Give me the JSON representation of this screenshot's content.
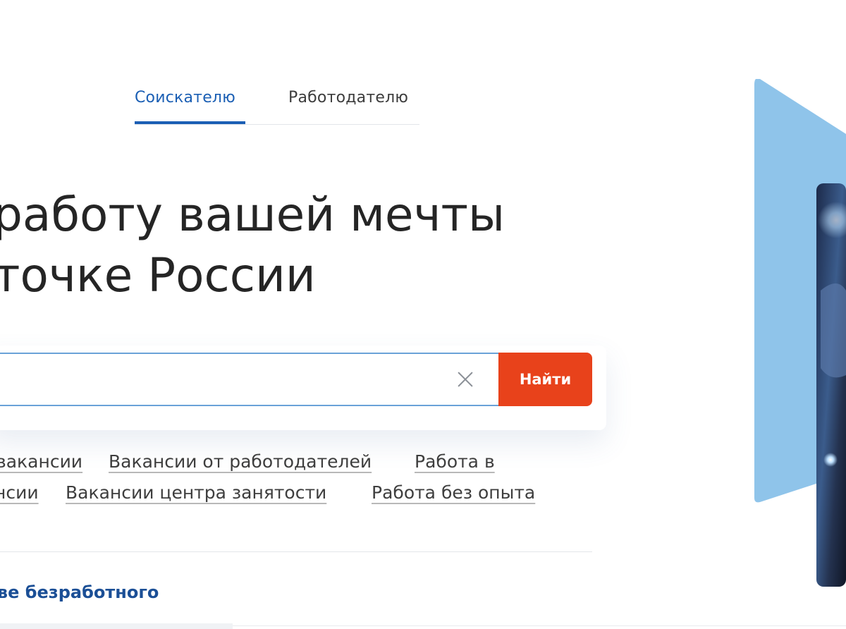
{
  "tabs": {
    "seeker": "Соискателю",
    "employer": "Работодателю"
  },
  "headline": {
    "line1": "работу вашей мечты",
    "line2": "точке России"
  },
  "search": {
    "value": "",
    "button": "Найти"
  },
  "quick_links": [
    "вакансии",
    "Вакансии от работодателей",
    "Работа в",
    "нсии",
    "Вакансии центра занятости",
    "Работа без опыта"
  ],
  "status_link": "тве безработного",
  "colors": {
    "accent": "#1b5fb4",
    "button": "#e8421b",
    "promo_shape": "#8fc4ea"
  }
}
